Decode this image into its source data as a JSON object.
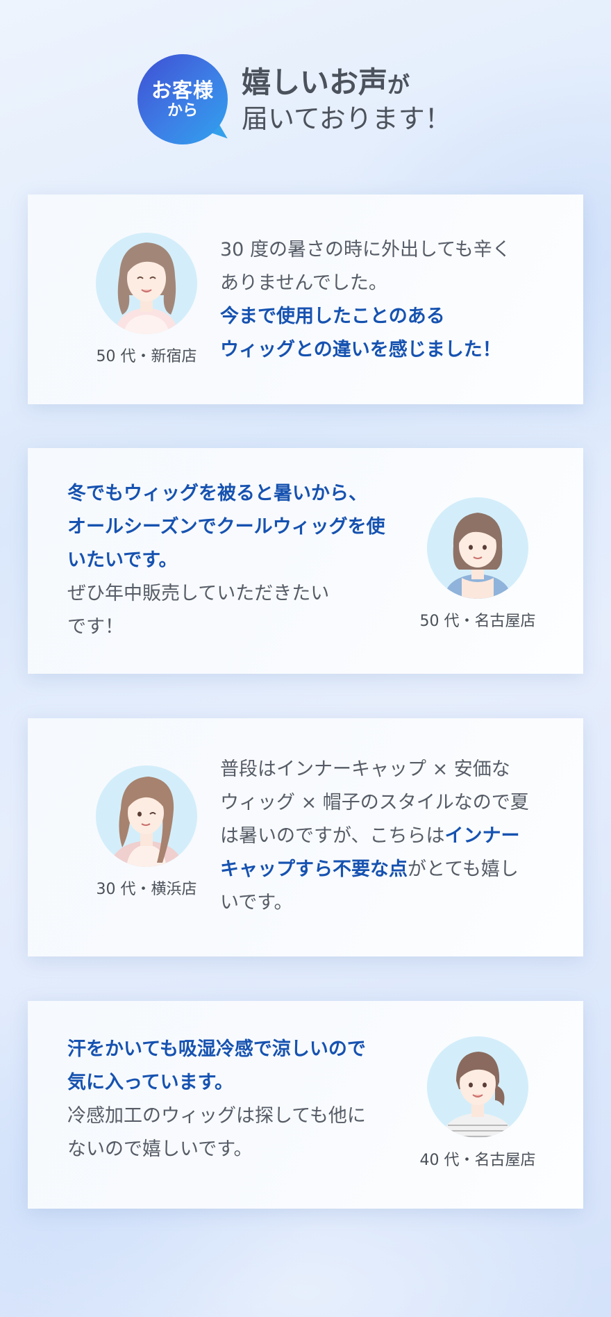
{
  "header": {
    "bubble_line1": "お客様",
    "bubble_line2": "から",
    "title_main": "嬉しいお声",
    "title_particle": "が",
    "title_line2": "届いております！"
  },
  "colors": {
    "accent_text": "#1652b0",
    "bubble_gradient_start": "#3f4fd3",
    "bubble_gradient_end": "#2fa3ee",
    "avatar_bg": "#d3eefa"
  },
  "testimonials": [
    {
      "age_store": "50 代・新宿店",
      "lines": [
        {
          "text": "30 度の暑さの時に外出しても辛く",
          "emphasis": false
        },
        {
          "text": "ありませんでした。",
          "emphasis": false
        },
        {
          "text": "今まで使用したことのある",
          "emphasis": true
        },
        {
          "text": "ウィッグとの違いを感じました！",
          "emphasis": true
        }
      ],
      "avatar_icon": "woman-long-wavy-hair-avatar"
    },
    {
      "age_store": "50 代・名古屋店",
      "lines": [
        {
          "text": "冬でもウィッグを被ると暑いから、",
          "emphasis": true
        },
        {
          "text": "オールシーズンでクールウィッグを使",
          "emphasis": true
        },
        {
          "text": "いたいです。",
          "emphasis": true
        },
        {
          "text": "ぜひ年中販売していただきたい",
          "emphasis": false
        },
        {
          "text": "です！",
          "emphasis": false
        }
      ],
      "avatar_icon": "woman-short-bob-avatar"
    },
    {
      "age_store": "30 代・横浜店",
      "lines": [
        [
          {
            "text": "普段はインナーキャップ × 安価な",
            "emphasis": false
          }
        ],
        [
          {
            "text": "ウィッグ × 帽子のスタイルなので夏",
            "emphasis": false
          }
        ],
        [
          {
            "text": "は暑いのですが、こちらは",
            "emphasis": false
          },
          {
            "text": "インナー",
            "emphasis": true
          }
        ],
        [
          {
            "text": "キャップすら不要な点",
            "emphasis": true
          },
          {
            "text": "がとても嬉し",
            "emphasis": false
          }
        ],
        [
          {
            "text": "いです。",
            "emphasis": false
          }
        ]
      ],
      "avatar_icon": "woman-long-side-hair-avatar"
    },
    {
      "age_store": "40 代・名古屋店",
      "lines": [
        {
          "text": "汗をかいても吸湿冷感で涼しいので",
          "emphasis": true
        },
        {
          "text": "気に入っています。",
          "emphasis": true
        },
        {
          "text": "冷感加工のウィッグは探しても他に",
          "emphasis": false
        },
        {
          "text": "ないので嬉しいです。",
          "emphasis": false
        }
      ],
      "avatar_icon": "woman-ponytail-avatar"
    }
  ]
}
